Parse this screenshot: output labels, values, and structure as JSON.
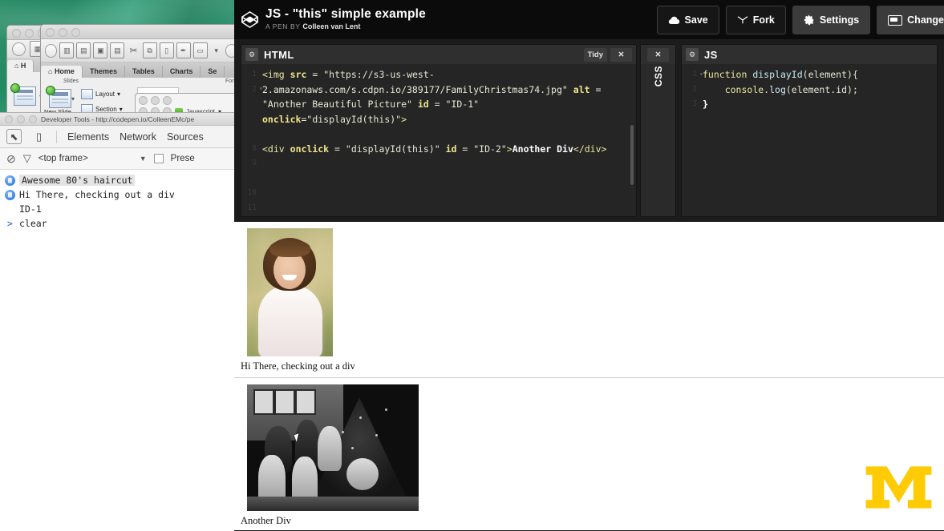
{
  "codepen": {
    "logo_icon": "codepen-hexagon-icon",
    "title": "JS - \"this\" simple example",
    "byline_prefix": "A PEN BY",
    "author": "Colleen van Lent",
    "actions": [
      {
        "label": "Save",
        "icon": "cloud-icon",
        "style": "outline"
      },
      {
        "label": "Fork",
        "icon": "fork-icon",
        "style": "outline"
      },
      {
        "label": "Settings",
        "icon": "gear-icon",
        "style": "solid"
      },
      {
        "label": "Change",
        "icon": "view-icon",
        "style": "solid"
      }
    ],
    "panes": {
      "html": {
        "name": "HTML",
        "gear_icon": "gear-icon",
        "tidy_label": "Tidy",
        "close_label": "✕",
        "line_numbers": [
          "1",
          "2",
          "",
          "",
          "",
          "",
          "8",
          "9",
          "",
          "10",
          "11"
        ],
        "code_plain": "<img src = \"https://s3-us-west-2.amazonaws.com/s.cdpn.io/389177/FamilyChristmas74.jpg\" alt = \"Another Beautiful Picture\" id = \"ID-1\" onclick=\"displayId(this)\">\n\n<div onclick = \"displayId(this)\" id = \"ID-2\">Another Div</div>",
        "tokens": {
          "img_tag": "<img",
          "attr_src": "src",
          "eq": "=",
          "src_value": "\"https://s3-us-west-2.amazonaws.com/s.cdpn.io/389177/FamilyChristmas74.jpg\"",
          "attr_alt": "alt",
          "alt_value": "\"Another Beautiful Picture\"",
          "attr_id": "id",
          "id_value_1": "\"ID-1\"",
          "attr_onclick": "onclick",
          "onclick_value": "\"displayId(this)\"",
          "close_bracket": ">",
          "div_open": "<div",
          "div_onclick": "onclick",
          "div_onclick_value": "\"displayId(this)\"",
          "div_id": "id",
          "div_id_value": "\"ID-2\"",
          "div_gt": ">",
          "div_text": "Another Div",
          "div_close": "</div>"
        }
      },
      "css": {
        "name": "CSS",
        "close_label": "✕",
        "collapsed": true
      },
      "js": {
        "name": "JS",
        "gear_icon": "gear-icon",
        "line_numbers": [
          "1",
          "2",
          "3"
        ],
        "code_plain": "function displayId(element){\n    console.log(element.id);\n}",
        "tokens": {
          "kw_function": "function",
          "fn_name": "displayId",
          "param_open": "(element){",
          "console": "console",
          "dot_log": ".log",
          "log_args": "(element.id);",
          "brace_close": "}"
        }
      }
    },
    "preview": {
      "caption_1": "Hi There, checking out a div",
      "caption_2": "Another Div",
      "image_1_alt": "Another Beautiful Picture",
      "image_2_alt": "FamilyChristmas74"
    }
  },
  "devtools": {
    "window_title": "Developer Tools - http://codepen.io/ColleenEMc/pe",
    "inspect_icon": "inspect-cursor-icon",
    "device_icon": "device-toggle-icon",
    "tabs": [
      "Elements",
      "Network",
      "Sources"
    ],
    "filter": {
      "clear_icon": "clear-console-icon",
      "funnel_icon": "filter-icon",
      "frame_selector": "<top frame>",
      "chevron_icon": "chevron-down-icon",
      "preserve_label": "Prese"
    },
    "console_rows": [
      {
        "icon": "info-icon",
        "text": "Awesome 80's haircut",
        "highlight": true
      },
      {
        "icon": "info-icon",
        "text": "Hi There, checking out a div",
        "highlight": false
      },
      {
        "icon": "none",
        "text": "ID-1",
        "highlight": false
      },
      {
        "icon": "prompt-icon",
        "text": "clear",
        "highlight": false
      }
    ]
  },
  "presentation_app": {
    "tabs": [
      "Home",
      "Themes",
      "Tables",
      "Charts",
      "Se"
    ],
    "active_tab": "Home",
    "groups": {
      "slides": "Slides",
      "font": "Font"
    },
    "ribbon_items": [
      {
        "label": "New Slide",
        "icon": "new-slide-icon"
      },
      {
        "label": "Layout",
        "icon": "layout-icon"
      },
      {
        "label": "Section",
        "icon": "section-icon"
      }
    ],
    "small_window_label": "Javascript"
  },
  "branding": {
    "logo": "michigan-block-m",
    "logo_color": "#FFCB05"
  },
  "colors": {
    "codepen_header_bg": "#0b0b0b",
    "editor_bg": "#252525",
    "pane_head_bg": "#2f2f2f",
    "accent_maize": "#FFCB05",
    "console_info_blue": "#2d7ff9"
  }
}
